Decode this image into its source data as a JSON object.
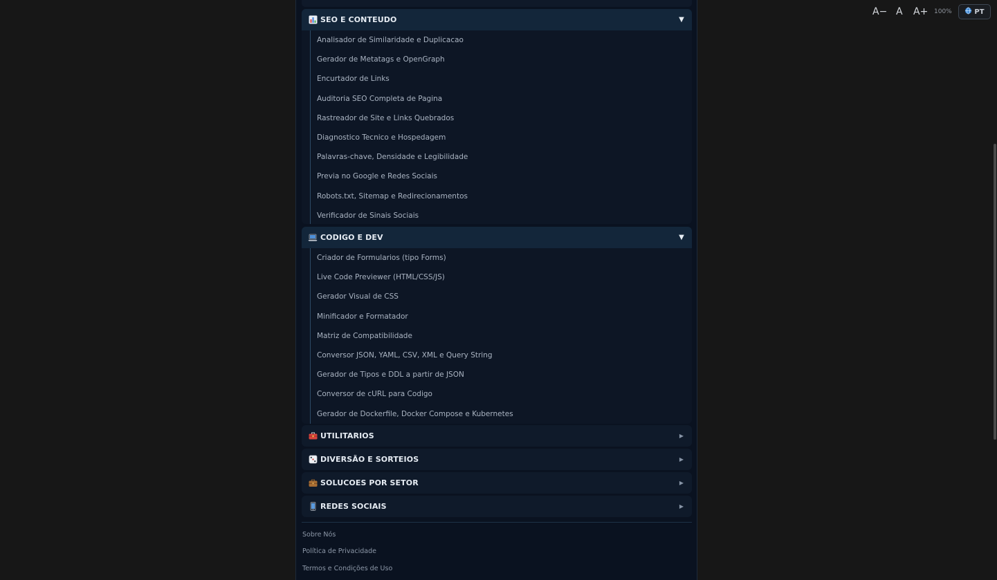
{
  "toolbar": {
    "font_decrease": "A−",
    "font_reset": "A",
    "font_increase": "A+",
    "zoom": "100%",
    "language": "PT"
  },
  "sections": {
    "seo": {
      "title": "SEO E CONTEUDO",
      "expanded": true,
      "items": [
        "Analisador de Similaridade e Duplicacao",
        "Gerador de Metatags e OpenGraph",
        "Encurtador de Links",
        "Auditoria SEO Completa de Pagina",
        "Rastreador de Site e Links Quebrados",
        "Diagnostico Tecnico e Hospedagem",
        "Palavras-chave, Densidade e Legibilidade",
        "Previa no Google e Redes Sociais",
        "Robots.txt, Sitemap e Redirecionamentos",
        "Verificador de Sinais Sociais"
      ]
    },
    "dev": {
      "title": "CODIGO E DEV",
      "expanded": true,
      "items": [
        "Criador de Formularios (tipo Forms)",
        "Live Code Previewer (HTML/CSS/JS)",
        "Gerador Visual de CSS",
        "Minificador e Formatador",
        "Matriz de Compatibilidade",
        "Conversor JSON, YAML, CSV, XML e Query String",
        "Gerador de Tipos e DDL a partir de JSON",
        "Conversor de cURL para Codigo",
        "Gerador de Dockerfile, Docker Compose e Kubernetes"
      ]
    },
    "utils": {
      "title": "UTILITARIOS",
      "expanded": false
    },
    "fun": {
      "title": "DIVERSÃO E SORTEIOS",
      "expanded": false
    },
    "sector": {
      "title": "SOLUCOES POR SETOR",
      "expanded": false
    },
    "social": {
      "title": "REDES SOCIAIS",
      "expanded": false
    }
  },
  "carets": {
    "expanded": "▼",
    "collapsed": "▶"
  },
  "footer": {
    "about": "Sobre Nós",
    "privacy": "Política de Privacidade",
    "terms": "Termos e Condições de Uso"
  }
}
